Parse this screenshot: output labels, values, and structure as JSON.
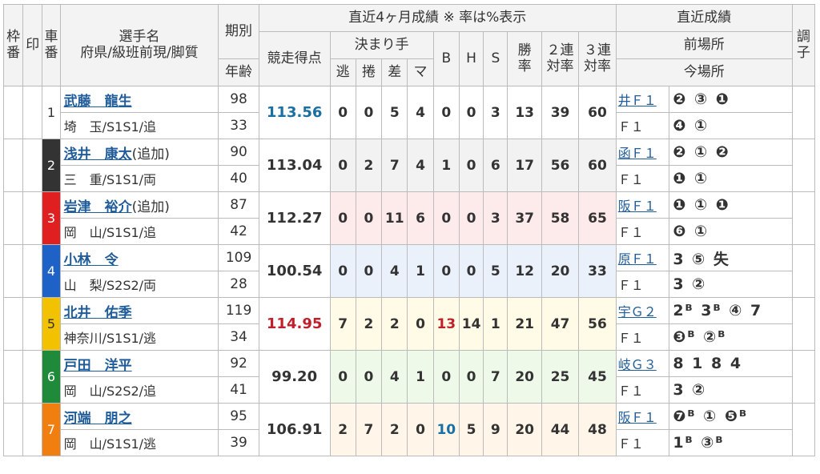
{
  "headers": {
    "frame": "枠番",
    "mark": "印",
    "car": "車番",
    "name_top": "選手名",
    "name_bottom": "府県/級班前現/脚質",
    "term": "期別",
    "age": "年齢",
    "recent4": "直近4ヶ月成績 ※ 率は%表示",
    "score": "競走得点",
    "kimarite": "決まり手",
    "nige": "逃",
    "makuri": "捲",
    "sashi": "差",
    "ma": "マ",
    "b": "B",
    "h": "H",
    "s": "S",
    "win_top": "勝",
    "win_bottom": "率",
    "ren2_top": "２連",
    "ren2_bottom": "対率",
    "ren3_top": "３連",
    "ren3_bottom": "対率",
    "recent": "直近成績",
    "prev_place": "前場所",
    "cur_place": "今場所",
    "condition": "調子"
  },
  "colors": {
    "frame1": "#ffffff",
    "frame2": "#333333",
    "frame3": "#e02020",
    "frame4": "#1e62c8",
    "frame5": "#f2c200",
    "frame6": "#1f8a3a",
    "frame7": "#f07f10"
  },
  "riders": [
    {
      "frame": "",
      "car": "1",
      "name": "武藤　龍生",
      "name_sub": "",
      "pref": "埼　玉/S1S1/追",
      "term": "98",
      "age": "33",
      "score": "113.56",
      "nige": "0",
      "makuri": "0",
      "sashi": "5",
      "ma": "4",
      "b": "0",
      "h": "0",
      "s": "3",
      "win": "13",
      "ren2": "39",
      "ren3": "60",
      "prev_place": "井Ｆ１",
      "prev_marks": "❷ ③ ❶",
      "cur_place": "Ｆ１",
      "cur_marks": "❹ ①"
    },
    {
      "frame": "2",
      "car": "",
      "name": "浅井　康太",
      "name_sub": "(追加)",
      "pref": "三　重/S1S1/両",
      "term": "90",
      "age": "40",
      "score": "113.04",
      "nige": "0",
      "makuri": "2",
      "sashi": "7",
      "ma": "4",
      "b": "1",
      "h": "0",
      "s": "6",
      "win": "17",
      "ren2": "56",
      "ren3": "60",
      "prev_place": "函Ｆ１",
      "prev_marks": "❷ ① ❷",
      "cur_place": "Ｆ１",
      "cur_marks": "❶ ①"
    },
    {
      "frame": "3",
      "car": "",
      "name": "岩津　裕介",
      "name_sub": "(追加)",
      "pref": "岡　山/S1S1/追",
      "term": "87",
      "age": "42",
      "score": "112.27",
      "nige": "0",
      "makuri": "0",
      "sashi": "11",
      "ma": "6",
      "b": "0",
      "h": "0",
      "s": "3",
      "win": "37",
      "ren2": "58",
      "ren3": "65",
      "prev_place": "阪Ｆ１",
      "prev_marks": "❶ ① ❶",
      "cur_place": "Ｆ１",
      "cur_marks": "❻ ①"
    },
    {
      "frame": "4",
      "car": "",
      "name": "小林　令",
      "name_sub": "",
      "pref": "山　梨/S2S2/両",
      "term": "109",
      "age": "28",
      "score": "100.54",
      "nige": "0",
      "makuri": "0",
      "sashi": "4",
      "ma": "1",
      "b": "0",
      "h": "0",
      "s": "5",
      "win": "12",
      "ren2": "20",
      "ren3": "33",
      "prev_place": "原Ｆ１",
      "prev_marks": "3 ⑤ 失",
      "cur_place": "Ｆ１",
      "cur_marks": "3 ②"
    },
    {
      "frame": "5",
      "car": "",
      "name": "北井　佑季",
      "name_sub": "",
      "pref": "神奈川/S1S1/逃",
      "term": "119",
      "age": "34",
      "score": "114.95",
      "nige": "7",
      "makuri": "2",
      "sashi": "2",
      "ma": "0",
      "b": "13",
      "h": "14",
      "s": "1",
      "win": "21",
      "ren2": "47",
      "ren3": "56",
      "prev_place": "宇Ｇ２",
      "prev_marks": "2ᴮ 3ᴮ ④ 7",
      "cur_place": "Ｆ１",
      "cur_marks": "❸ᴮ ②ᴮ"
    },
    {
      "frame": "6",
      "car": "",
      "name": "戸田　洋平",
      "name_sub": "",
      "pref": "岡　山/S2S2/追",
      "term": "92",
      "age": "41",
      "score": "99.20",
      "nige": "0",
      "makuri": "0",
      "sashi": "4",
      "ma": "1",
      "b": "0",
      "h": "0",
      "s": "7",
      "win": "20",
      "ren2": "25",
      "ren3": "45",
      "prev_place": "岐Ｇ３",
      "prev_marks": "8 1 8 4",
      "cur_place": "Ｆ１",
      "cur_marks": "3 ②"
    },
    {
      "frame": "7",
      "car": "",
      "name": "河端　朋之",
      "name_sub": "",
      "pref": "岡　山/S1S1/逃",
      "term": "95",
      "age": "39",
      "score": "106.91",
      "nige": "2",
      "makuri": "7",
      "sashi": "2",
      "ma": "0",
      "b": "10",
      "h": "5",
      "s": "9",
      "win": "20",
      "ren2": "44",
      "ren3": "48",
      "prev_place": "阪Ｆ１",
      "prev_marks": "❼ᴮ ① ❺ᴮ",
      "cur_place": "Ｆ１",
      "cur_marks": "1ᴮ ③ᴮ"
    }
  ]
}
